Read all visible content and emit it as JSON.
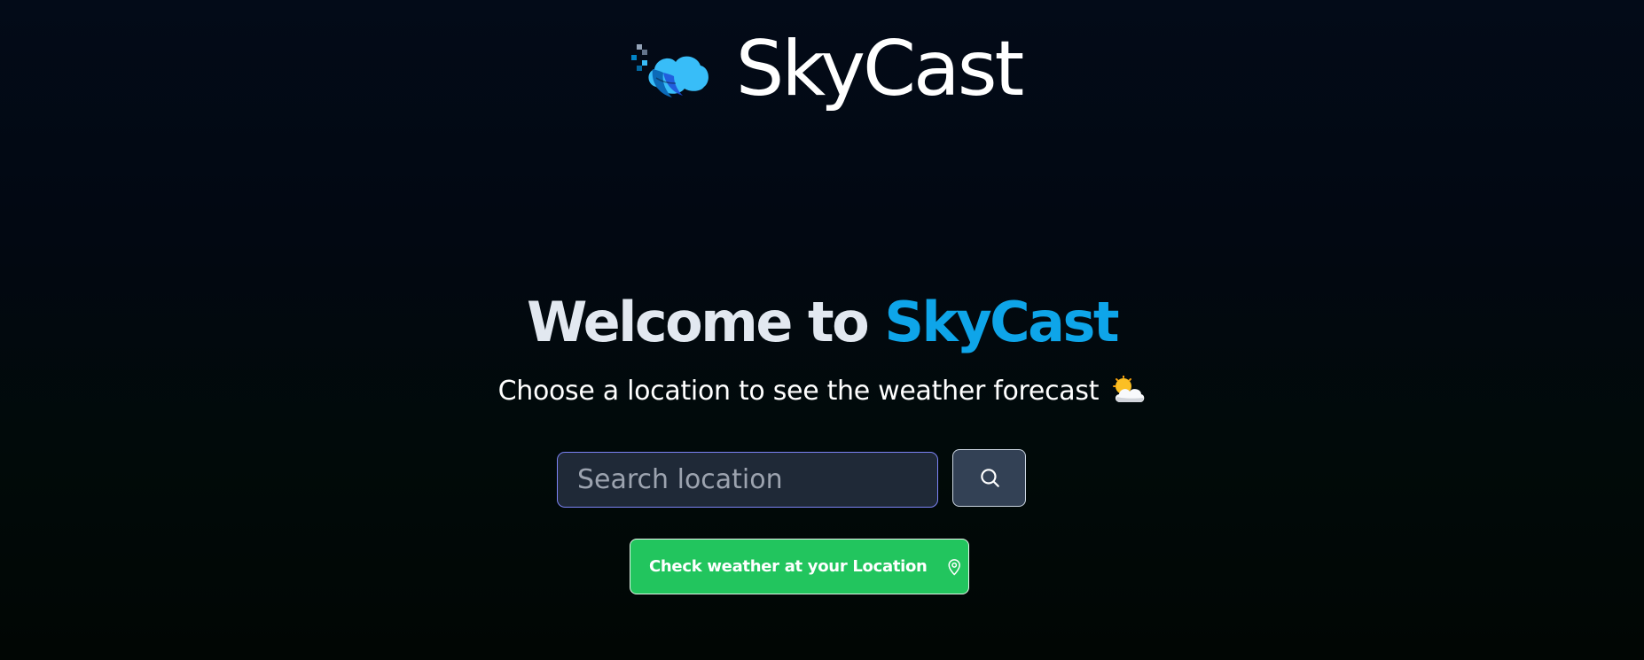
{
  "brand": {
    "name": "SkyCast",
    "logo_icon": "skycast-cloud-logo-icon"
  },
  "hero": {
    "title_prefix": "Welcome to ",
    "title_accent": "SkyCast",
    "subtitle": "Choose a location to see the weather forecast",
    "subtitle_icon": "sun-behind-cloud-icon"
  },
  "search": {
    "placeholder": "Search location",
    "value": "",
    "button_icon": "search-icon"
  },
  "location_button": {
    "label": "Check weather at your Location",
    "icon": "map-pin-icon"
  },
  "colors": {
    "accent": "#0ea5e9",
    "primary_button": "#22c55e",
    "search_button": "#334155",
    "input_background": "#1f2937",
    "input_focus_border": "#7c83f6",
    "background_top": "#030b18",
    "background_bottom": "#010604"
  }
}
